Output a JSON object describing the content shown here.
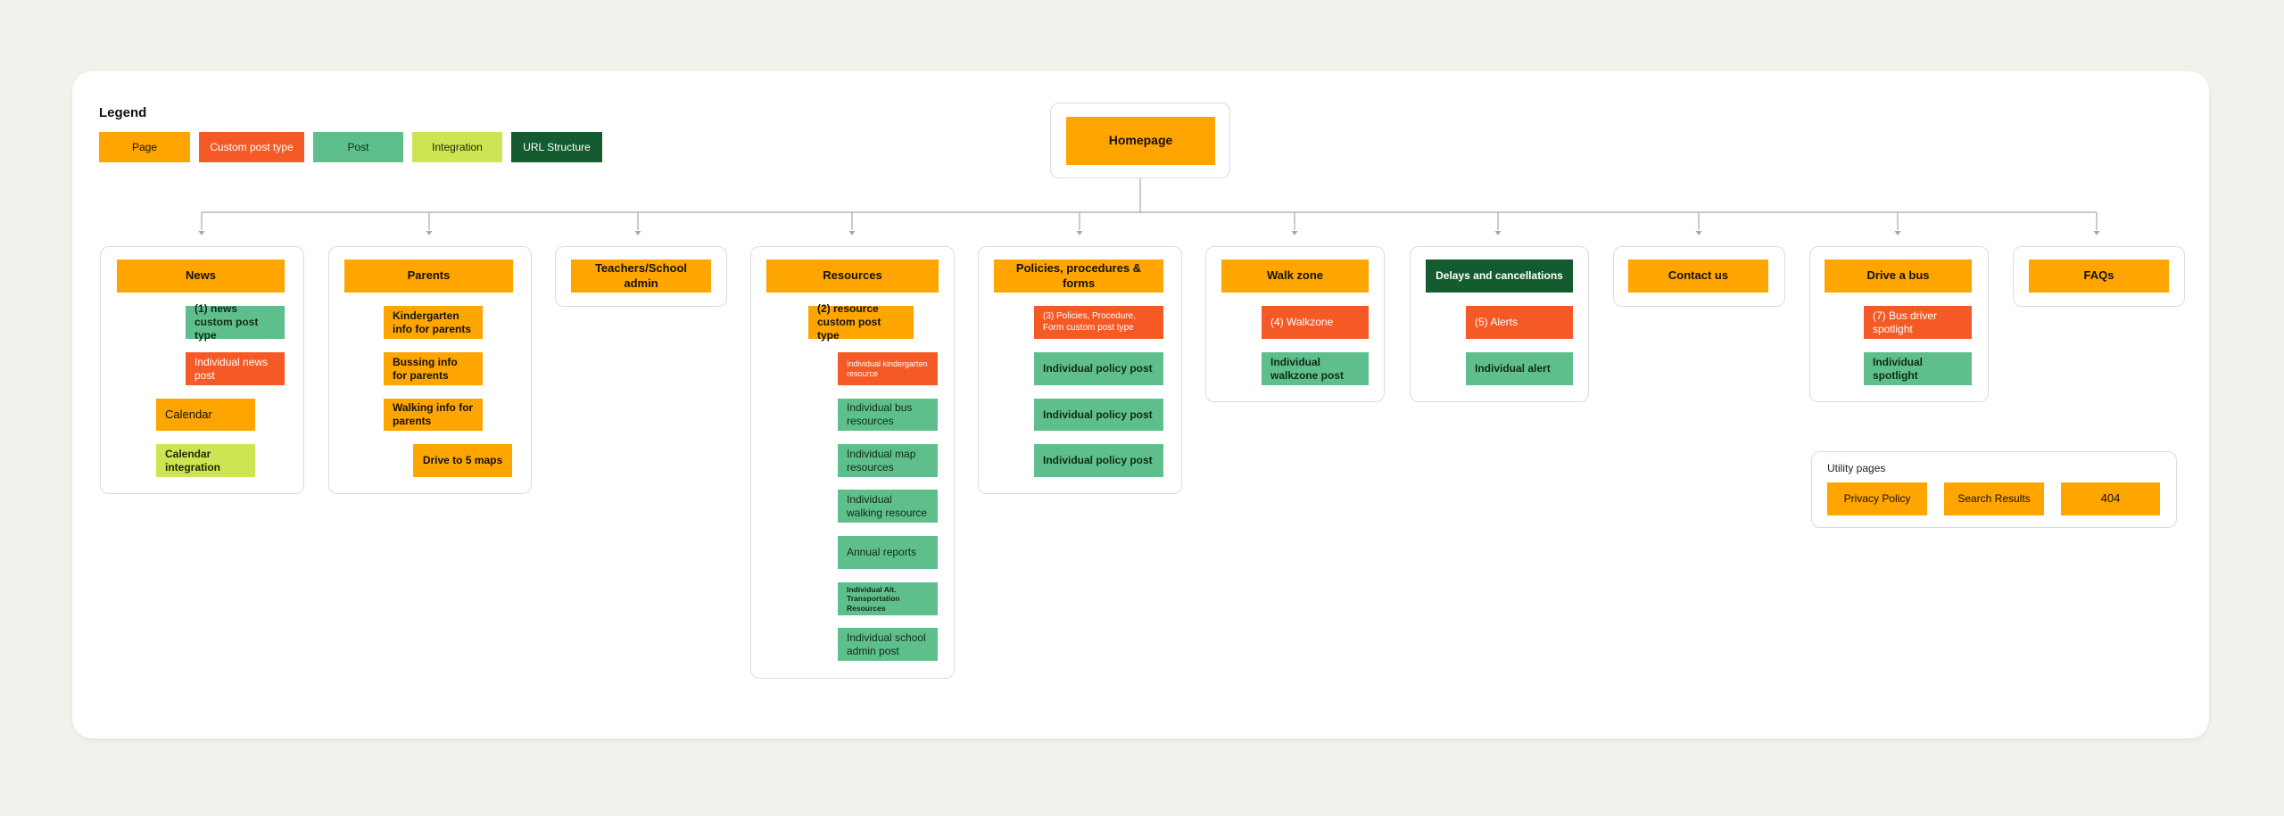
{
  "legend": {
    "title": "Legend",
    "items": [
      "Page",
      "Custom post type",
      "Post",
      "Integration",
      "URL Structure"
    ]
  },
  "homepage": "Homepage",
  "sections": {
    "news": {
      "title": "News",
      "cpt": "(1) news custom post type",
      "individual": "Individual news post",
      "calendar": "Calendar",
      "calendar_integration": "Calendar integration"
    },
    "parents": {
      "title": "Parents",
      "items": [
        "Kindergarten info for parents",
        "Bussing info for parents",
        "Walking info for parents"
      ],
      "drive": "Drive to 5 maps"
    },
    "teachers": {
      "title": "Teachers/School admin"
    },
    "resources": {
      "title": "Resources",
      "cpt": "(2) resource custom post type",
      "items": [
        "Individual kindergarten resource",
        "Individual bus resources",
        "Individual map resources",
        "Individual walking resource",
        "Annual reports",
        "Individual Alt. Transportation Resources",
        "Individual school admin post"
      ]
    },
    "policies": {
      "title": "Policies, procedures & forms",
      "cpt": "(3) Policies, Procedure, Form custom post type",
      "items": [
        "Individual policy post",
        "Individual policy post",
        "Individual policy post"
      ]
    },
    "walkzone": {
      "title": "Walk zone",
      "cpt": "(4) Walkzone",
      "post": "Individual walkzone post"
    },
    "delays": {
      "title": "Delays and cancellations",
      "cpt": "(5) Alerts",
      "post": "Individual alert"
    },
    "contact": {
      "title": "Contact us"
    },
    "drivebus": {
      "title": "Drive a bus",
      "cpt": "(7) Bus driver spotlight",
      "post": "Individual spotlight"
    },
    "faqs": {
      "title": "FAQs"
    }
  },
  "utility": {
    "title": "Utility pages",
    "items": [
      "Privacy Policy",
      "Search Results",
      "404"
    ]
  }
}
